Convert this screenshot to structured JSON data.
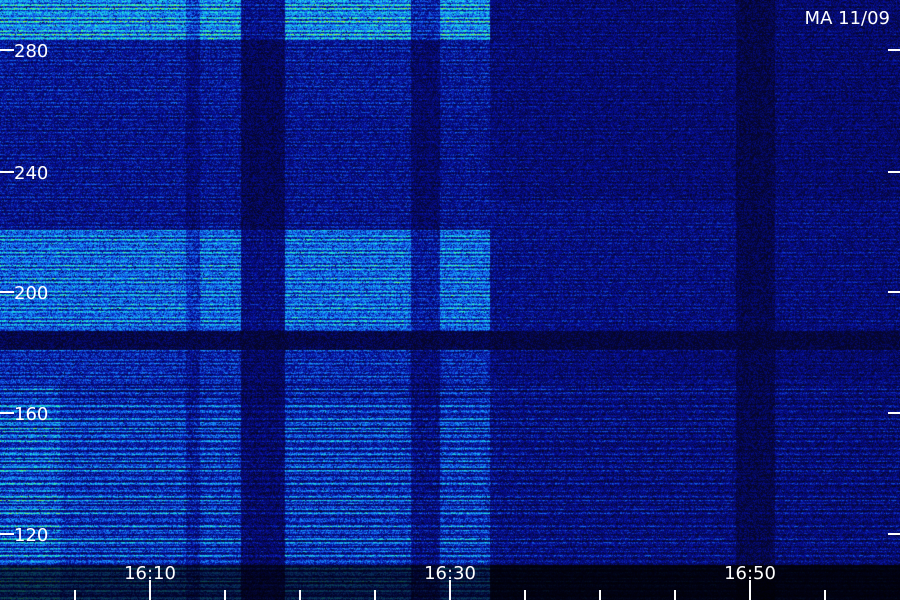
{
  "chart_data": {
    "type": "heatmap",
    "title": "MA 11/09",
    "xlabel": "",
    "ylabel": "",
    "x_ticks": [
      "16:10",
      "16:30",
      "16:50"
    ],
    "y_ticks": [
      "280",
      "240",
      "200",
      "160",
      "120"
    ],
    "y_tick_values": [
      280,
      240,
      200,
      160,
      120
    ],
    "x_range": [
      "16:08",
      "16:58"
    ],
    "y_range": [
      102,
      290
    ],
    "colors": {
      "background": "#000000",
      "low": "#0a0a5a",
      "mid": "#1565ff",
      "high": "#20ffc0",
      "peak": "#60ff20"
    }
  }
}
